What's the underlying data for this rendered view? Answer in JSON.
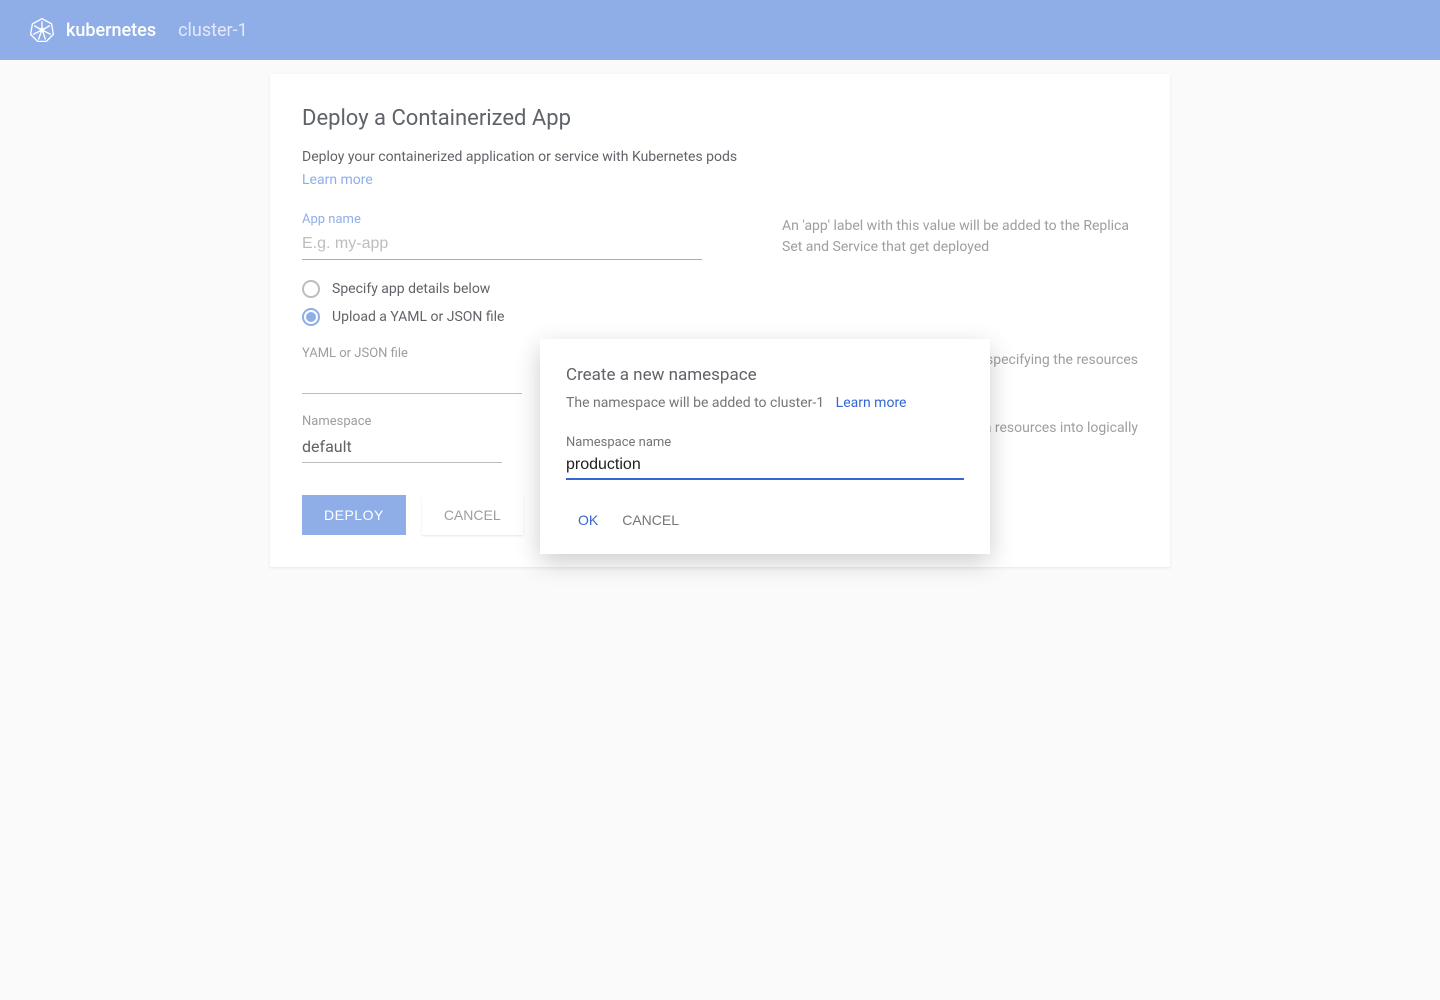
{
  "header": {
    "brand": "kubernetes",
    "cluster": "cluster-1"
  },
  "card": {
    "title": "Deploy a Containerized App",
    "subtitle": "Deploy your containerized application or service with Kubernetes pods",
    "learn_more": "Learn more",
    "app_name": {
      "label": "App name",
      "placeholder": "E.g. my-app",
      "helper": "An 'app' label with this value will be added to the Replica Set and Service that get deployed"
    },
    "radio": {
      "option1": "Specify app details below",
      "option2": "Upload a YAML or JSON file"
    },
    "yaml": {
      "label": "YAML or JSON file",
      "helper": "specifying the  resources"
    },
    "namespace": {
      "label": "Namespace",
      "value": "default",
      "helper": "on resources into logically"
    },
    "buttons": {
      "deploy": "DEPLOY",
      "cancel": "CANCEL"
    }
  },
  "dialog": {
    "title": "Create a new namespace",
    "subtitle": "The namespace will be added to cluster-1",
    "learn_more": "Learn more",
    "field_label": "Namespace name",
    "field_value": "production",
    "ok": "OK",
    "cancel": "CANCEL"
  }
}
